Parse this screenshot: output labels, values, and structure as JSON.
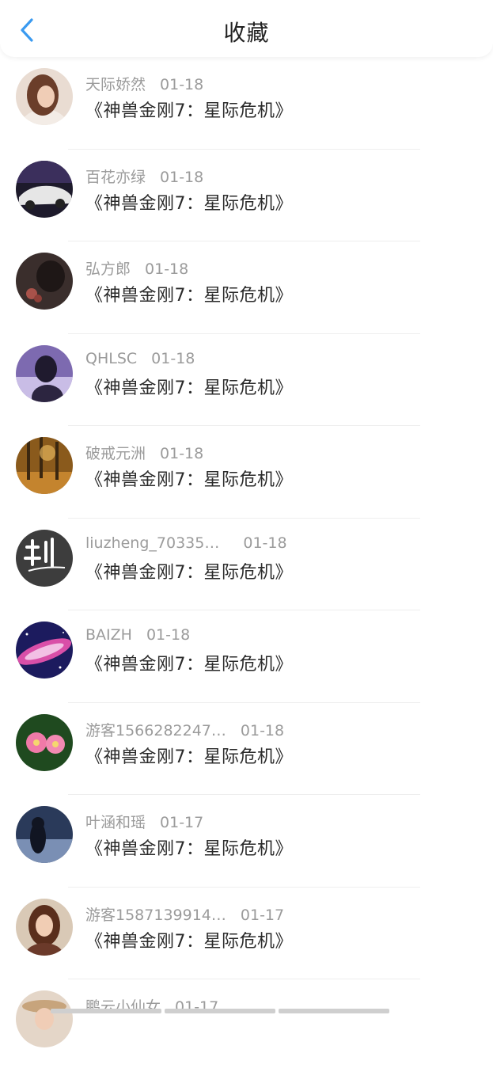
{
  "header": {
    "title": "收藏",
    "back_icon": "chevron-left-icon"
  },
  "colors": {
    "accent": "#3a9af0",
    "meta_text": "#9b9b9b",
    "title_text": "#2a2a2a"
  },
  "favorites": [
    {
      "user": "天际娇然",
      "date": "01-18",
      "movie": "《神兽金刚7：星际危机》"
    },
    {
      "user": "百花亦绿",
      "date": "01-18",
      "movie": "《神兽金刚7：星际危机》"
    },
    {
      "user": "弘方郎",
      "date": "01-18",
      "movie": "《神兽金刚7：星际危机》"
    },
    {
      "user": "QHLSC",
      "date": "01-18",
      "movie": "《神兽金刚7：星际危机》"
    },
    {
      "user": "破戒元洲",
      "date": "01-18",
      "movie": "《神兽金刚7：星际危机》"
    },
    {
      "user": "liuzheng_70335…",
      "date": "01-18",
      "movie": "《神兽金刚7：星际危机》"
    },
    {
      "user": "BAIZH",
      "date": "01-18",
      "movie": "《神兽金刚7：星际危机》"
    },
    {
      "user": "游客1566282247…",
      "date": "01-18",
      "movie": "《神兽金刚7：星际危机》"
    },
    {
      "user": "叶涵和瑶",
      "date": "01-17",
      "movie": "《神兽金刚7：星际危机》"
    },
    {
      "user": "游客1587139914…",
      "date": "01-17",
      "movie": "《神兽金刚7：星际危机》"
    },
    {
      "user": "鹏云小仙女",
      "date": "01-17",
      "movie": ""
    }
  ]
}
